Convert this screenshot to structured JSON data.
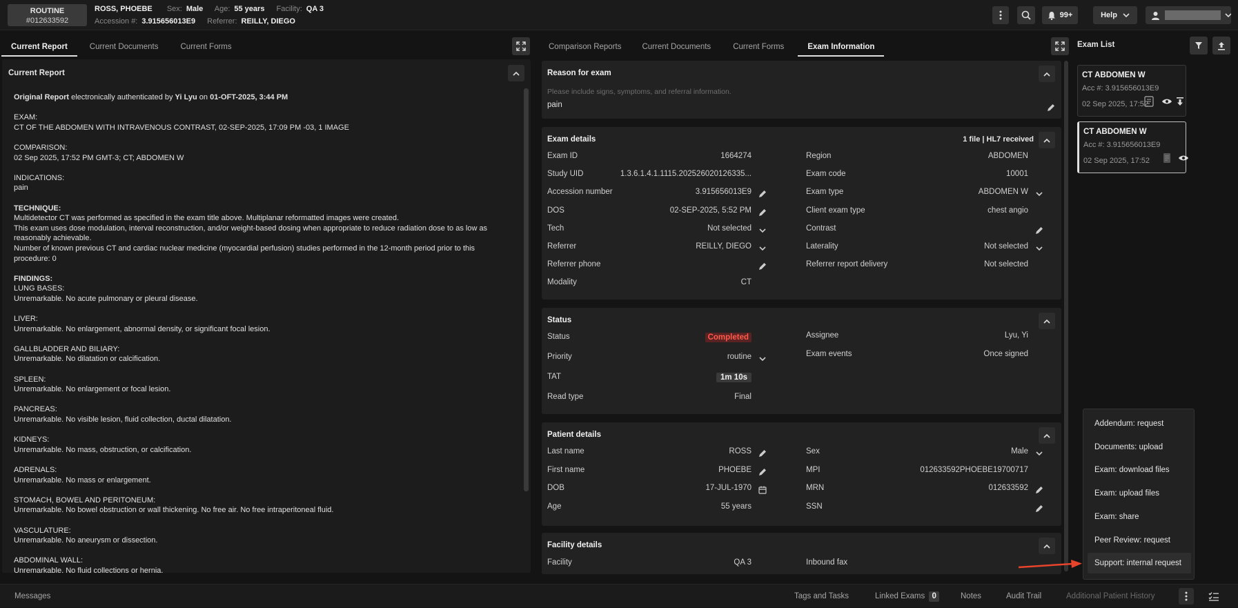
{
  "header": {
    "priority": "ROUTINE",
    "patient_id": "#012633592",
    "patient_name": "ROSS, PHOEBE",
    "sex_label": "Sex:",
    "sex": "Male",
    "age_label": "Age:",
    "age": "55 years",
    "facility_label": "Facility:",
    "facility": "QA 3",
    "accession_label": "Accession #:",
    "accession": "3.915656013E9",
    "referrer_label": "Referrer:",
    "referrer": "REILLY, DIEGO",
    "notifications": "99+",
    "help": "Help"
  },
  "left_panel": {
    "tabs": [
      "Current Report",
      "Current Documents",
      "Current Forms"
    ],
    "active_tab": "Current Report",
    "card_title": "Current Report",
    "auth_line": {
      "prefix": "Original Report",
      "middle": " electronically authenticated by ",
      "author": "Yi Lyu",
      "on": " on ",
      "datetime": "01-OFT-2025, 3:44 PM"
    },
    "report": [
      {
        "heading": "EXAM:",
        "bold": false,
        "text": "CT OF THE ABDOMEN WITH INTRAVENOUS CONTRAST, 02-SEP-2025, 17:09 PM -03, 1 IMAGE"
      },
      {
        "heading": "COMPARISON:",
        "bold": false,
        "text": "02 Sep 2025, 17:52 PM GMT-3; CT; ABDOMEN W"
      },
      {
        "heading": "INDICATIONS:",
        "bold": false,
        "text": "pain"
      },
      {
        "heading": "TECHNIQUE:",
        "bold": true,
        "text": "Multidetector CT was performed as specified in the exam title above. Multiplanar reformatted images were created.\nThis exam uses dose modulation, interval reconstruction, and/or weight-based dosing when appropriate to reduce radiation dose to as low as reasonably achievable.\nNumber of known previous CT and cardiac nuclear medicine (myocardial perfusion) studies performed in the 12-month period prior to this procedure: 0"
      },
      {
        "heading": "FINDINGS:",
        "bold": true,
        "text": "LUNG BASES:\nUnremarkable. No acute pulmonary or pleural disease."
      },
      {
        "heading": "LIVER:",
        "bold": false,
        "text": "Unremarkable. No enlargement, abnormal density, or significant focal lesion."
      },
      {
        "heading": "GALLBLADDER AND BILIARY:",
        "bold": false,
        "text": "Unremarkable. No dilatation or calcification."
      },
      {
        "heading": "SPLEEN:",
        "bold": false,
        "text": "Unremarkable. No enlargement or focal lesion."
      },
      {
        "heading": "PANCREAS:",
        "bold": false,
        "text": "Unremarkable. No visible lesion, fluid collection, ductal dilatation."
      },
      {
        "heading": "KIDNEYS:",
        "bold": false,
        "text": "Unremarkable. No mass, obstruction, or calcification."
      },
      {
        "heading": "ADRENALS:",
        "bold": false,
        "text": "Unremarkable. No mass or enlargement."
      },
      {
        "heading": "STOMACH, BOWEL AND PERITONEUM:",
        "bold": false,
        "text": "Unremarkable. No bowel obstruction or wall thickening. No free air. No free intraperitoneal fluid."
      },
      {
        "heading": "VASCULATURE:",
        "bold": false,
        "text": "Unremarkable. No aneurysm or dissection."
      },
      {
        "heading": "ABDOMINAL WALL:",
        "bold": false,
        "text": "Unremarkable. No fluid collections or hernia."
      }
    ]
  },
  "middle_panel": {
    "tabs": [
      "Comparison Reports",
      "Current Documents",
      "Current Forms",
      "Exam Information"
    ],
    "active_tab": "Exam Information",
    "reason": {
      "title": "Reason for exam",
      "placeholder": "Please include signs, symptoms, and referral information.",
      "value": "pain"
    },
    "exam_details": {
      "title": "Exam details",
      "badge": "1 file | HL7 received",
      "left": [
        {
          "k": "Exam ID",
          "v": "1664274"
        },
        {
          "k": "Study UID",
          "v": "1.3.6.1.4.1.1115.202526020126335..."
        },
        {
          "k": "Accession number",
          "v": "3.915656013E9"
        },
        {
          "k": "DOS",
          "v": "02-SEP-2025, 5:52 PM"
        },
        {
          "k": "Tech",
          "v": "Not selected"
        },
        {
          "k": "Referrer",
          "v": "REILLY, DIEGO"
        },
        {
          "k": "Referrer phone",
          "v": ""
        },
        {
          "k": "Modality",
          "v": "CT"
        }
      ],
      "right": [
        {
          "k": "Region",
          "v": "ABDOMEN"
        },
        {
          "k": "Exam code",
          "v": "10001"
        },
        {
          "k": "Exam type",
          "v": "ABDOMEN W"
        },
        {
          "k": "Client exam type",
          "v": "chest angio"
        },
        {
          "k": "Contrast",
          "v": ""
        },
        {
          "k": "Laterality",
          "v": "Not selected"
        },
        {
          "k": "Referrer report delivery",
          "v": "Not selected"
        }
      ]
    },
    "status": {
      "title": "Status",
      "left": [
        {
          "k": "Status",
          "v": "Completed"
        },
        {
          "k": "Priority",
          "v": "routine"
        },
        {
          "k": "TAT",
          "v": "1m 10s"
        },
        {
          "k": "Read type",
          "v": "Final"
        }
      ],
      "right": [
        {
          "k": "Assignee",
          "v": "Lyu, Yi"
        },
        {
          "k": "Exam events",
          "v": "Once signed"
        }
      ]
    },
    "patient": {
      "title": "Patient details",
      "left": [
        {
          "k": "Last name",
          "v": "ROSS"
        },
        {
          "k": "First name",
          "v": "PHOEBE"
        },
        {
          "k": "DOB",
          "v": "17-JUL-1970"
        },
        {
          "k": "Age",
          "v": "55 years"
        }
      ],
      "right": [
        {
          "k": "Sex",
          "v": "Male"
        },
        {
          "k": "MPI",
          "v": "012633592PHOEBE19700717"
        },
        {
          "k": "MRN",
          "v": "012633592"
        },
        {
          "k": "SSN",
          "v": ""
        }
      ]
    },
    "facility": {
      "title": "Facility details",
      "left": [
        {
          "k": "Facility",
          "v": "QA 3"
        }
      ],
      "right": [
        {
          "k": "Inbound fax",
          "v": ""
        }
      ]
    }
  },
  "exam_list": {
    "title": "Exam List",
    "items": [
      {
        "title": "CT ABDOMEN W",
        "acc": "Acc #: 3.915656013E9",
        "date": "02 Sep 2025, 17:52"
      },
      {
        "title": "CT ABDOMEN W",
        "acc": "Acc #: 3.915656013E9",
        "date": "02 Sep 2025, 17:52"
      }
    ]
  },
  "context_menu": {
    "items": [
      "Addendum: request",
      "Documents: upload",
      "Exam: download files",
      "Exam: upload files",
      "Exam: share",
      "Peer Review: request",
      "Support: internal request"
    ],
    "highlighted": "Support: internal request"
  },
  "bottom_bar": {
    "messages": "Messages",
    "tags": "Tags and Tasks",
    "linked": "Linked Exams",
    "linked_count": "0",
    "notes": "Notes",
    "audit": "Audit Trail",
    "history": "Additional Patient History"
  },
  "colors": {
    "status_completed_bg": "#5a2222",
    "status_completed_fg": "#ff5a4a",
    "arrow": "#e8442c"
  }
}
